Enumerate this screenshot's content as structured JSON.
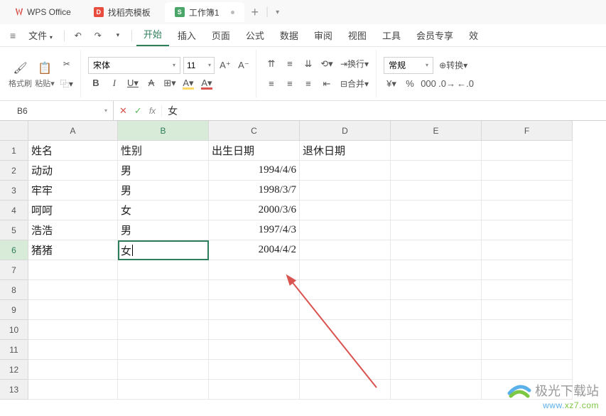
{
  "app": {
    "name": "WPS Office"
  },
  "tabs": [
    {
      "label": "找稻壳模板",
      "icon": "red"
    },
    {
      "label": "工作簿1",
      "icon": "green",
      "active": true
    }
  ],
  "menubar": {
    "file": "文件",
    "items": [
      "开始",
      "插入",
      "页面",
      "公式",
      "数据",
      "审阅",
      "视图",
      "工具",
      "会员专享",
      "效"
    ],
    "active": "开始"
  },
  "ribbon": {
    "format_painter": "格式刷",
    "paste": "粘贴",
    "font_name": "宋体",
    "font_size": "11",
    "wrap": "换行",
    "merge": "合并",
    "number_format": "常规",
    "convert": "转换"
  },
  "formula_bar": {
    "cell_ref": "B6",
    "value": "女"
  },
  "columns": [
    "A",
    "B",
    "C",
    "D",
    "E",
    "F"
  ],
  "row_numbers": [
    "1",
    "2",
    "3",
    "4",
    "5",
    "6",
    "7",
    "8",
    "9",
    "10",
    "11",
    "12",
    "13"
  ],
  "active_col": "B",
  "active_row": "6",
  "chart_data": {
    "type": "table",
    "headers": [
      "姓名",
      "性别",
      "出生日期",
      "退休日期"
    ],
    "rows": [
      [
        "动动",
        "男",
        "1994/4/6",
        ""
      ],
      [
        "牢牢",
        "男",
        "1998/3/7",
        ""
      ],
      [
        "呵呵",
        "女",
        "2000/3/6",
        ""
      ],
      [
        "浩浩",
        "男",
        "1997/4/3",
        ""
      ],
      [
        "猪猪",
        "女",
        "2004/4/2",
        ""
      ]
    ]
  },
  "watermark": {
    "text": "极光下载站",
    "url_a": "www.",
    "url_b": "xz7.com"
  }
}
